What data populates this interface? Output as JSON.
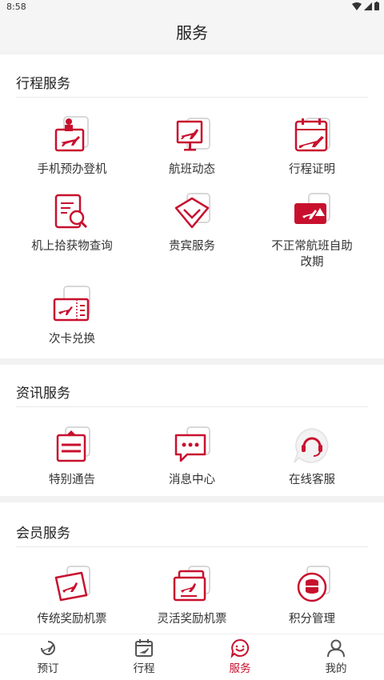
{
  "status_bar": {
    "time": "8:58"
  },
  "header": {
    "title": "服务"
  },
  "sections": {
    "trip": {
      "title": "行程服务",
      "items": [
        {
          "label": "手机预办登机",
          "icon": "checkin-icon"
        },
        {
          "label": "航班动态",
          "icon": "flight-status-icon"
        },
        {
          "label": "行程证明",
          "icon": "itinerary-proof-icon"
        },
        {
          "label": "机上拾获物查询",
          "icon": "lost-found-icon"
        },
        {
          "label": "贵宾服务",
          "icon": "vip-service-icon"
        },
        {
          "label": "不正常航班自助",
          "label2": "改期",
          "icon": "irregular-flight-icon"
        },
        {
          "label": "次卡兑换",
          "icon": "card-exchange-icon"
        }
      ]
    },
    "info": {
      "title": "资讯服务",
      "items": [
        {
          "label": "特别通告",
          "icon": "notice-icon"
        },
        {
          "label": "消息中心",
          "icon": "message-icon"
        },
        {
          "label": "在线客服",
          "icon": "customer-service-icon"
        }
      ]
    },
    "member": {
      "title": "会员服务",
      "items": [
        {
          "label": "传统奖励机票",
          "icon": "award-ticket-icon"
        },
        {
          "label": "灵活奖励机票",
          "icon": "flexible-ticket-icon"
        },
        {
          "label": "积分管理",
          "icon": "points-icon"
        }
      ]
    }
  },
  "tabbar": {
    "tabs": [
      {
        "label": "预订",
        "icon": "booking-icon"
      },
      {
        "label": "行程",
        "icon": "trip-calendar-icon"
      },
      {
        "label": "服务",
        "icon": "service-icon",
        "active": true
      },
      {
        "label": "我的",
        "icon": "profile-icon"
      }
    ]
  },
  "colors": {
    "accent": "#c8102e",
    "card_shadow": "#dcdcdc"
  }
}
